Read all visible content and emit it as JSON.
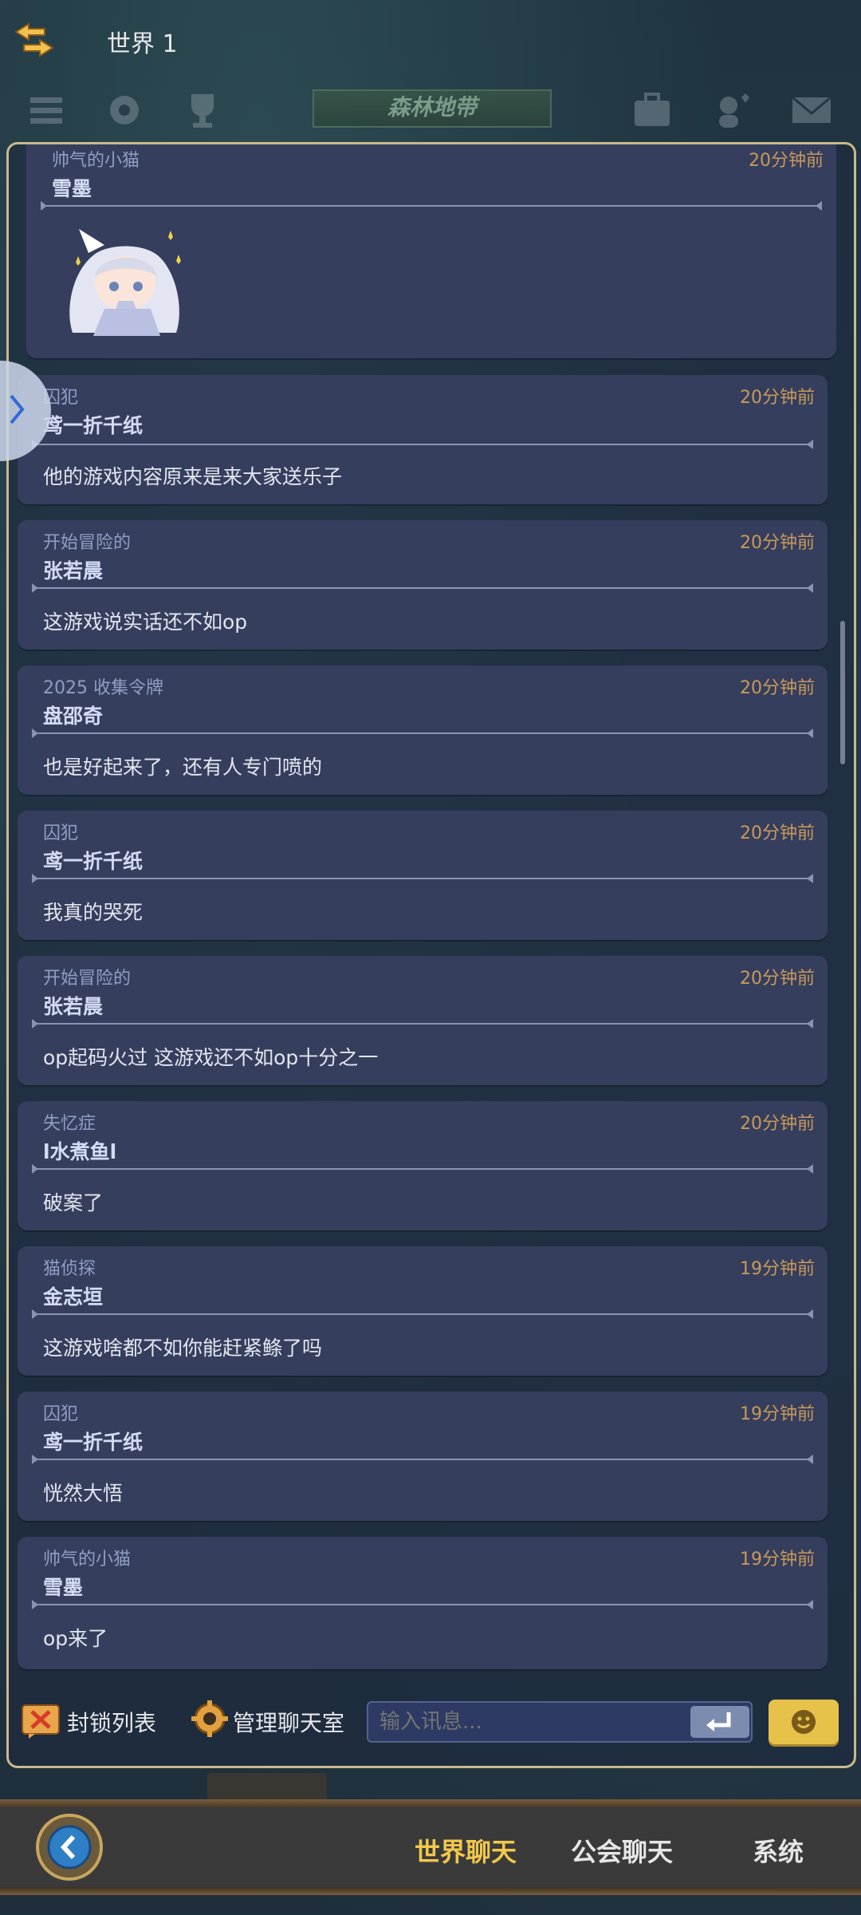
{
  "header": {
    "world_title": "世界 1",
    "zone_name": "森林地带"
  },
  "messages": [
    {
      "rank": "帅气的小猫",
      "user": "雪墨",
      "time": "20分钟前",
      "text": "",
      "sticker": "anime-girl-sticker"
    },
    {
      "rank": "囚犯",
      "user": "鸢一折千纸",
      "time": "20分钟前",
      "text": "他的游戏内容原来是来大家送乐子"
    },
    {
      "rank": "开始冒险的",
      "user": "张若晨",
      "time": "20分钟前",
      "text": "这游戏说实话还不如op"
    },
    {
      "rank": "2025 收集令牌",
      "user": "盘邵奇",
      "time": "20分钟前",
      "text": "也是好起来了，还有人专门喷的"
    },
    {
      "rank": "囚犯",
      "user": "鸢一折千纸",
      "time": "20分钟前",
      "text": "我真的哭死"
    },
    {
      "rank": "开始冒险的",
      "user": "张若晨",
      "time": "20分钟前",
      "text": "op起码火过 这游戏还不如op十分之一"
    },
    {
      "rank": "失忆症",
      "user": "l水煮鱼l",
      "time": "20分钟前",
      "text": "破案了"
    },
    {
      "rank": "猫侦探",
      "user": "金志垣",
      "time": "19分钟前",
      "text": "这游戏啥都不如你能赶紧鲦了吗"
    },
    {
      "rank": "囚犯",
      "user": "鸢一折千纸",
      "time": "19分钟前",
      "text": "恍然大悟"
    },
    {
      "rank": "帅气的小猫",
      "user": "雪墨",
      "time": "19分钟前",
      "text": "op来了"
    }
  ],
  "controls": {
    "block_list": "封锁列表",
    "manage_room": "管理聊天室",
    "input_placeholder": "输入讯息..."
  },
  "tabs": [
    {
      "label": "世界聊天",
      "active": true
    },
    {
      "label": "公会聊天",
      "active": false
    },
    {
      "label": "系统",
      "active": false
    }
  ],
  "colors": {
    "accent": "#f2c84b",
    "panel_border": "#c9b98c",
    "message_bg": "#363e5e",
    "time": "#c79a5a"
  }
}
